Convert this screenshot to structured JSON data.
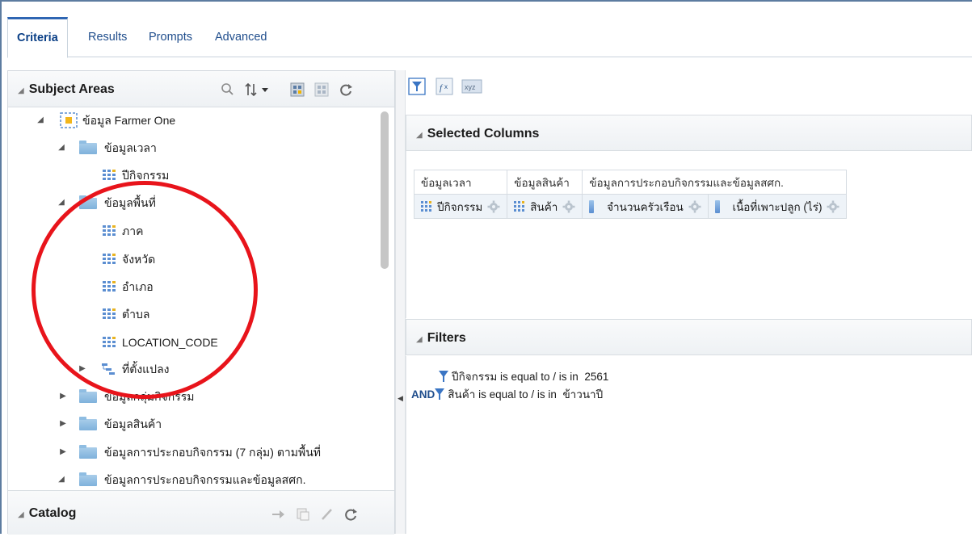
{
  "tabs": [
    {
      "label": "Criteria",
      "active": true
    },
    {
      "label": "Results",
      "active": false
    },
    {
      "label": "Prompts",
      "active": false
    },
    {
      "label": "Advanced",
      "active": false
    }
  ],
  "subject_areas": {
    "title": "Subject Areas",
    "tree": [
      {
        "label": "ข้อมูล Farmer One",
        "kind": "subject",
        "twisty": "expanded"
      },
      {
        "label": "ข้อมูลเวลา",
        "kind": "folder",
        "twisty": "expanded"
      },
      {
        "label": "ปีกิจกรรม",
        "kind": "column"
      },
      {
        "label": "ข้อมูลพื้นที่",
        "kind": "folder",
        "twisty": "expanded"
      },
      {
        "label": "ภาค",
        "kind": "column"
      },
      {
        "label": "จังหวัด",
        "kind": "column"
      },
      {
        "label": "อำเภอ",
        "kind": "column"
      },
      {
        "label": "ตำบล",
        "kind": "column"
      },
      {
        "label": "LOCATION_CODE",
        "kind": "column"
      },
      {
        "label": "ที่ตั้งแปลง",
        "kind": "hierarchy",
        "twisty": "collapsed"
      },
      {
        "label": "ข้อมูลกลุ่มกิจกรรม",
        "kind": "folder",
        "twisty": "collapsed"
      },
      {
        "label": "ข้อมูลสินค้า",
        "kind": "folder",
        "twisty": "collapsed"
      },
      {
        "label": "ข้อมูลการประกอบกิจกรรม (7 กลุ่ม) ตามพื้นที่",
        "kind": "folder",
        "twisty": "collapsed"
      },
      {
        "label": "ข้อมูลการประกอบกิจกรรมและข้อมูลสศก.",
        "kind": "folder",
        "twisty": "expanded"
      }
    ]
  },
  "catalog": {
    "title": "Catalog"
  },
  "selected_columns": {
    "title": "Selected Columns",
    "groups": [
      {
        "label": "ข้อมูลเวลา",
        "span": 1
      },
      {
        "label": "ข้อมูลสินค้า",
        "span": 1
      },
      {
        "label": "ข้อมูลการประกอบกิจกรรมและข้อมูลสศก.",
        "span": 2
      }
    ],
    "columns": [
      {
        "label": "ปีกิจกรรม",
        "kind": "attribute"
      },
      {
        "label": "สินค้า",
        "kind": "attribute"
      },
      {
        "label": "จำนวนครัวเรือน",
        "kind": "measure"
      },
      {
        "label": "เนื้อที่เพาะปลูก (ไร่)",
        "kind": "measure"
      }
    ]
  },
  "filters": {
    "title": "Filters",
    "items": [
      {
        "connector": "",
        "column": "ปีกิจกรรม",
        "operator": "is equal to / is in",
        "value": "2561"
      },
      {
        "connector": "AND",
        "column": "สินค้า",
        "operator": "is equal to / is in",
        "value": "ข้าวนาปี"
      }
    ]
  },
  "colors": {
    "accent": "#2f66b3",
    "highlight": "#e8141b",
    "folder": "#7eb1db"
  }
}
